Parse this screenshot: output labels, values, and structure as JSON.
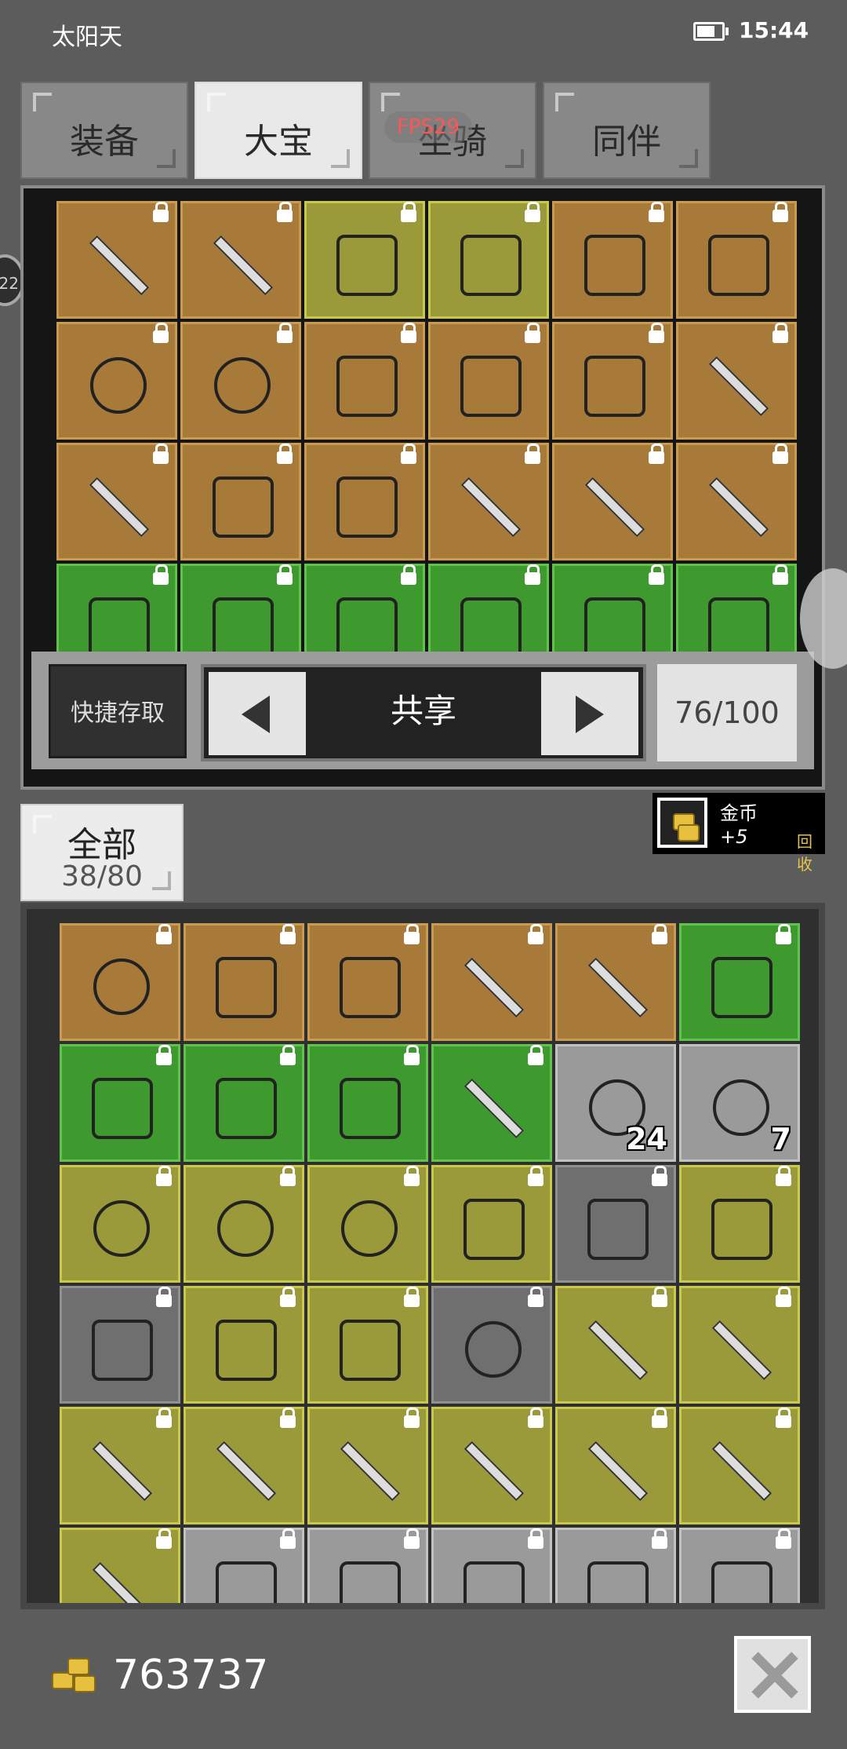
{
  "status_bar": {
    "carrier": "太阳天",
    "time": "15:44"
  },
  "tabs": [
    {
      "label": "装备",
      "active": false
    },
    {
      "label": "大宝",
      "active": true
    },
    {
      "label": "坐骑",
      "active": false
    },
    {
      "label": "同伴",
      "active": false
    }
  ],
  "fps_overlay": "FPS29",
  "floating_badge": "22",
  "storage": {
    "quick_access_label": "快捷存取",
    "mode_label": "共享",
    "capacity": "76/100",
    "rows": [
      [
        {
          "tier": "brown",
          "icon": "sword-icon"
        },
        {
          "tier": "brown",
          "icon": "sword-icon"
        },
        {
          "tier": "olive",
          "icon": "santa-hat-icon"
        },
        {
          "tier": "olive",
          "icon": "scroll-icon"
        },
        {
          "tier": "brown",
          "icon": "armor-icon"
        },
        {
          "tier": "brown",
          "icon": "armor-icon"
        }
      ],
      [
        {
          "tier": "brown",
          "icon": "blue-orb-icon"
        },
        {
          "tier": "brown",
          "icon": "blue-orb-icon"
        },
        {
          "tier": "brown",
          "icon": "hood-icon"
        },
        {
          "tier": "brown",
          "icon": "glove-icon"
        },
        {
          "tier": "brown",
          "icon": "glove-icon"
        },
        {
          "tier": "brown",
          "icon": "scythe-icon"
        }
      ],
      [
        {
          "tier": "brown",
          "icon": "spear-icon"
        },
        {
          "tier": "brown",
          "icon": "unicorn-mask-icon"
        },
        {
          "tier": "brown",
          "icon": "unicorn-mask-icon"
        },
        {
          "tier": "brown",
          "icon": "gold-sword-icon"
        },
        {
          "tier": "brown",
          "icon": "gold-sword-icon"
        },
        {
          "tier": "brown",
          "icon": "gold-sword-icon"
        }
      ],
      [
        {
          "tier": "green",
          "icon": "belt-icon"
        },
        {
          "tier": "green",
          "icon": "chest-armor-icon"
        },
        {
          "tier": "green",
          "icon": "dark-helmet-icon"
        },
        {
          "tier": "green",
          "icon": "dark-helmet-icon"
        },
        {
          "tier": "green",
          "icon": "wizard-hat-icon"
        },
        {
          "tier": "green",
          "icon": "wizard-hat-icon"
        }
      ]
    ]
  },
  "gold_chip": {
    "name": "金币",
    "bonus": "+5",
    "recycle": "回收"
  },
  "inventory": {
    "tab_label": "全部",
    "tab_count": "38/80",
    "rows": [
      [
        {
          "tier": "brown",
          "icon": "moon-shield-icon"
        },
        {
          "tier": "brown",
          "icon": "glove-icon"
        },
        {
          "tier": "brown",
          "icon": "unicorn-mask-icon"
        },
        {
          "tier": "brown",
          "icon": "gold-sword-icon"
        },
        {
          "tier": "brown",
          "icon": "gold-sword-icon"
        },
        {
          "tier": "green",
          "icon": "belt-icon"
        }
      ],
      [
        {
          "tier": "green",
          "icon": "belt-icon"
        },
        {
          "tier": "green",
          "icon": "gauntlet-icon"
        },
        {
          "tier": "green",
          "icon": "chest-armor-icon"
        },
        {
          "tier": "green",
          "icon": "purple-sword-icon"
        },
        {
          "tier": "gray",
          "icon": "gold-pile-icon",
          "count": "24"
        },
        {
          "tier": "gray",
          "icon": "ore-icon",
          "count": "7"
        }
      ],
      [
        {
          "tier": "olive",
          "icon": "ring-icon"
        },
        {
          "tier": "olive",
          "icon": "ring-icon"
        },
        {
          "tier": "olive",
          "icon": "amulet-icon"
        },
        {
          "tier": "olive",
          "icon": "portrait-card-icon"
        },
        {
          "tier": "slate",
          "icon": "horned-armor-icon"
        },
        {
          "tier": "olive",
          "icon": "horned-armor-icon"
        }
      ],
      [
        {
          "tier": "slate",
          "icon": "minotaur-helmet-icon"
        },
        {
          "tier": "olive",
          "icon": "chain-glove-icon"
        },
        {
          "tier": "olive",
          "icon": "shield-icon"
        },
        {
          "tier": "slate",
          "icon": "skull-helmet-icon"
        },
        {
          "tier": "olive",
          "icon": "spear-icon"
        },
        {
          "tier": "olive",
          "icon": "spear-icon"
        }
      ],
      [
        {
          "tier": "olive",
          "icon": "spear-icon"
        },
        {
          "tier": "olive",
          "icon": "spear-icon"
        },
        {
          "tier": "olive",
          "icon": "spear-icon"
        },
        {
          "tier": "olive",
          "icon": "red-boomerang-icon"
        },
        {
          "tier": "olive",
          "icon": "red-boomerang-icon"
        },
        {
          "tier": "olive",
          "icon": "broadsword-icon"
        }
      ],
      [
        {
          "tier": "olive",
          "icon": "crystal-sword-icon"
        },
        {
          "tier": "gray",
          "icon": "scroll-case-icon"
        },
        {
          "tier": "gray",
          "icon": "potion-icon"
        },
        {
          "tier": "gray",
          "icon": "potion-icon"
        },
        {
          "tier": "gray",
          "icon": "vial-icon"
        },
        {
          "tier": "gray",
          "icon": "vial-icon"
        }
      ]
    ]
  },
  "money": "763737",
  "colors": {
    "brown": "#a87a3a",
    "olive": "#9a9a3a",
    "green": "#3e9a2e",
    "gray": "#9a9a9a",
    "slate": "#6f6f6f"
  }
}
